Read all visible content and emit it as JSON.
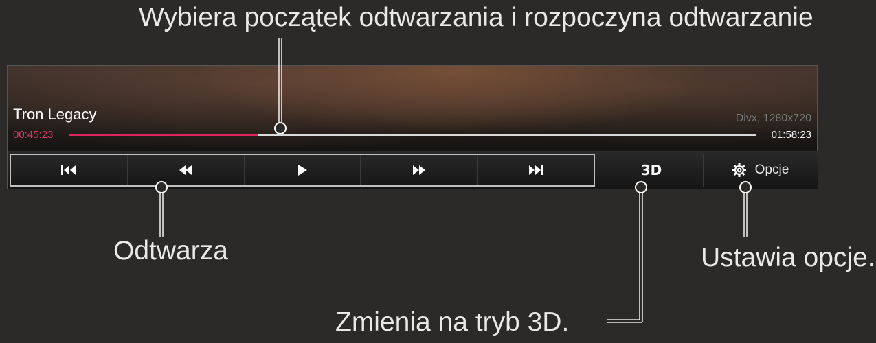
{
  "callouts": {
    "seek": "Wybiera początek odtwarzania i rozpoczyna odtwarzanie",
    "playback": "Odtwarza",
    "options": "Ustawia opcje.",
    "mode3d": "Zmienia na tryb 3D."
  },
  "player": {
    "title": "Tron Legacy",
    "file_info": "Divx, 1280x720",
    "elapsed": "00:45:23",
    "total": "01:58:23",
    "progress_fraction": 0.275,
    "accent_color": "#e0245e"
  },
  "controls": {
    "buttons": [
      {
        "icon": "skip-previous-icon",
        "glyph": "⏮"
      },
      {
        "icon": "rewind-icon",
        "glyph": "⏪"
      },
      {
        "icon": "play-icon",
        "glyph": "▶"
      },
      {
        "icon": "fast-forward-icon",
        "glyph": "⏩"
      },
      {
        "icon": "skip-next-icon",
        "glyph": "⏭"
      }
    ],
    "mode_3d_label": "3D",
    "options_label": "Opcje",
    "options_icon": "gear-icon"
  }
}
